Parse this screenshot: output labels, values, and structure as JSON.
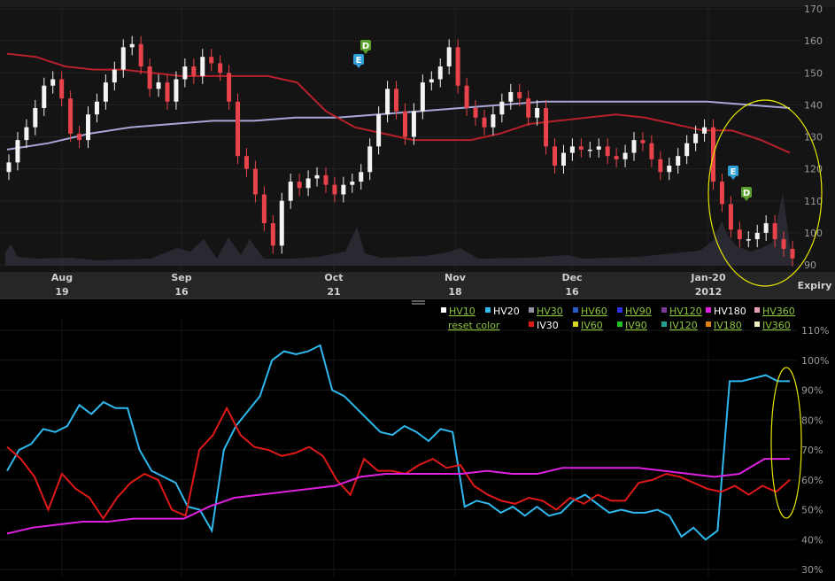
{
  "colors": {
    "background": "#000000",
    "panel": "#141414",
    "up_candle": "#f4f4f4",
    "down_candle": "#e8434a",
    "ma_short": "#b8202a",
    "ma_long": "#a8a8d8",
    "volume": "#2a2a34",
    "highlight_ellipse": "#e5e500",
    "link_green": "#8dc63f",
    "hv20": "#2fb8ee",
    "iv30": "#e01818",
    "hv180": "#e020e0"
  },
  "price_panel": {
    "y_axis": {
      "ticks": [
        "170",
        "160",
        "150",
        "140",
        "130",
        "120",
        "110",
        "100",
        "90"
      ]
    },
    "x_axis": {
      "months": [
        "Aug",
        "Sep",
        "Oct",
        "Nov",
        "Dec",
        "Jan-20"
      ],
      "days": [
        "19",
        "16",
        "21",
        "18",
        "16",
        "2012"
      ],
      "expiry_label": "Expiry"
    },
    "event_markers": [
      {
        "icon": "D",
        "color": "#5aa02c"
      },
      {
        "icon": "E",
        "color": "#2e9fd8"
      },
      {
        "icon": "E",
        "color": "#2e9fd8"
      },
      {
        "icon": "D",
        "color": "#5aa02c"
      }
    ]
  },
  "legend": {
    "row1": [
      {
        "label": "HV10",
        "color": "#ffffff",
        "link": true
      },
      {
        "label": "HV20",
        "color": "#2fb8ee",
        "link": false
      },
      {
        "label": "HV30",
        "color": "#9090a0",
        "link": true
      },
      {
        "label": "HV60",
        "color": "#2a5cc8",
        "link": true
      },
      {
        "label": "HV90",
        "color": "#3030e0",
        "link": true
      },
      {
        "label": "HV120",
        "color": "#7a3a9a",
        "link": true
      },
      {
        "label": "HV180",
        "color": "#e020e0",
        "link": false
      },
      {
        "label": "HV360",
        "color": "#e4a0b0",
        "link": true
      }
    ],
    "reset_label": "reset color",
    "row2": [
      {
        "label": "IV30",
        "color": "#e01818",
        "link": false
      },
      {
        "label": "IV60",
        "color": "#d8d820",
        "link": true
      },
      {
        "label": "IV90",
        "color": "#20c020",
        "link": true
      },
      {
        "label": "IV120",
        "color": "#20a090",
        "link": true
      },
      {
        "label": "IV180",
        "color": "#e08010",
        "link": true
      },
      {
        "label": "IV360",
        "color": "#f0f0c0",
        "link": true
      }
    ]
  },
  "chart_data": [
    {
      "type": "candlestick",
      "title": "",
      "ylim": [
        90,
        170
      ],
      "y_ticks": [
        90,
        100,
        110,
        120,
        130,
        140,
        150,
        160,
        170
      ],
      "x_labels": [
        "Aug 19",
        "Sep 16",
        "Oct 21",
        "Nov 18",
        "Dec 16",
        "Jan-20 2012"
      ],
      "closes": [
        122,
        129,
        133,
        139,
        146,
        148,
        142,
        131,
        129,
        137,
        141,
        147,
        151,
        158,
        159,
        152,
        145,
        147,
        141,
        148,
        152,
        149,
        155,
        153,
        150,
        141,
        124,
        120,
        112,
        103,
        96,
        110,
        116,
        114,
        117,
        118,
        115,
        112,
        115,
        116,
        119,
        127,
        137,
        145,
        138,
        130,
        138,
        147,
        148,
        152,
        158,
        146,
        139,
        136,
        133,
        137,
        141,
        144,
        142,
        136,
        139,
        127,
        121,
        125,
        127,
        126,
        126,
        127,
        124,
        123,
        125,
        129,
        128,
        123,
        119,
        121,
        124,
        128,
        131,
        133,
        116,
        109,
        101,
        98,
        98,
        100,
        103,
        98,
        95,
        92
      ],
      "ma_short": [
        156,
        155,
        152,
        151,
        151,
        150,
        149,
        149,
        149,
        149,
        147,
        138,
        133,
        131,
        129,
        129,
        129,
        131,
        134,
        135,
        136,
        137,
        136,
        134,
        132,
        132,
        129,
        125
      ],
      "ma_long": [
        126,
        128,
        131,
        133,
        134,
        135,
        135,
        136,
        136,
        137,
        138,
        139,
        140,
        141,
        141,
        141,
        141,
        141,
        140,
        139
      ]
    },
    {
      "type": "line",
      "title": "",
      "ylim": [
        30,
        110
      ],
      "y_ticks": [
        "30%",
        "40%",
        "50%",
        "60%",
        "70%",
        "80%",
        "90%",
        "100%",
        "110%"
      ],
      "series": [
        {
          "name": "HV20",
          "values": [
            63,
            70,
            72,
            77,
            76,
            78,
            85,
            82,
            86,
            84,
            84,
            70,
            63,
            61,
            59,
            51,
            50,
            43,
            70,
            78,
            83,
            88,
            100,
            103,
            102,
            103,
            105,
            90,
            88,
            84,
            80,
            76,
            75,
            78,
            76,
            73,
            77,
            76,
            51,
            53,
            52,
            49,
            51,
            48,
            51,
            48,
            49,
            53,
            55,
            52,
            49,
            50,
            49,
            49,
            50,
            48,
            41,
            44,
            40,
            43,
            93,
            93,
            94,
            95,
            93,
            93
          ]
        },
        {
          "name": "IV30",
          "values": [
            71,
            67,
            61,
            50,
            62,
            57,
            54,
            47,
            54,
            59,
            62,
            60,
            50,
            48,
            70,
            75,
            84,
            75,
            71,
            70,
            68,
            69,
            71,
            68,
            60,
            55,
            67,
            63,
            63,
            62,
            65,
            67,
            64,
            65,
            58,
            55,
            53,
            52,
            54,
            53,
            50,
            54,
            52,
            55,
            53,
            53,
            59,
            60,
            62,
            61,
            59,
            57,
            56,
            58,
            55,
            58,
            56,
            60
          ]
        },
        {
          "name": "HV180",
          "values": [
            42,
            44,
            45,
            46,
            46,
            47,
            47,
            47,
            51,
            54,
            55,
            56,
            57,
            58,
            61,
            62,
            62,
            62,
            62,
            63,
            62,
            62,
            64,
            64,
            64,
            64,
            63,
            62,
            61,
            62,
            67,
            67
          ]
        }
      ]
    }
  ]
}
